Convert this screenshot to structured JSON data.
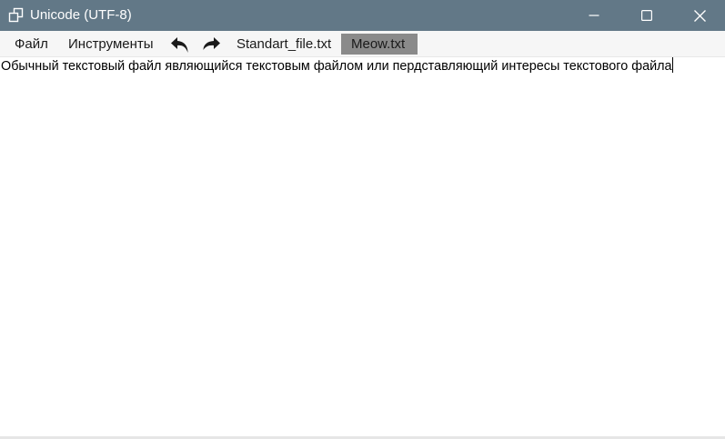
{
  "window": {
    "title": "Unicode (UTF-8)",
    "title_bar_color": "#627887"
  },
  "icons": {
    "app": "restore-windows-icon",
    "minimize": "minimize-icon",
    "maximize": "maximize-icon",
    "close": "close-icon",
    "undo": "undo-arrow-icon",
    "redo": "redo-arrow-icon"
  },
  "menu": {
    "file_label": "Файл",
    "tools_label": "Инструменты"
  },
  "tabs": [
    {
      "label": "Standart_file.txt",
      "active": false
    },
    {
      "label": "Meow.txt",
      "active": true
    }
  ],
  "editor": {
    "content": "Обычный текстовый файл являющийся текстовым файлом или пердставляющий интересы текстового файла"
  }
}
